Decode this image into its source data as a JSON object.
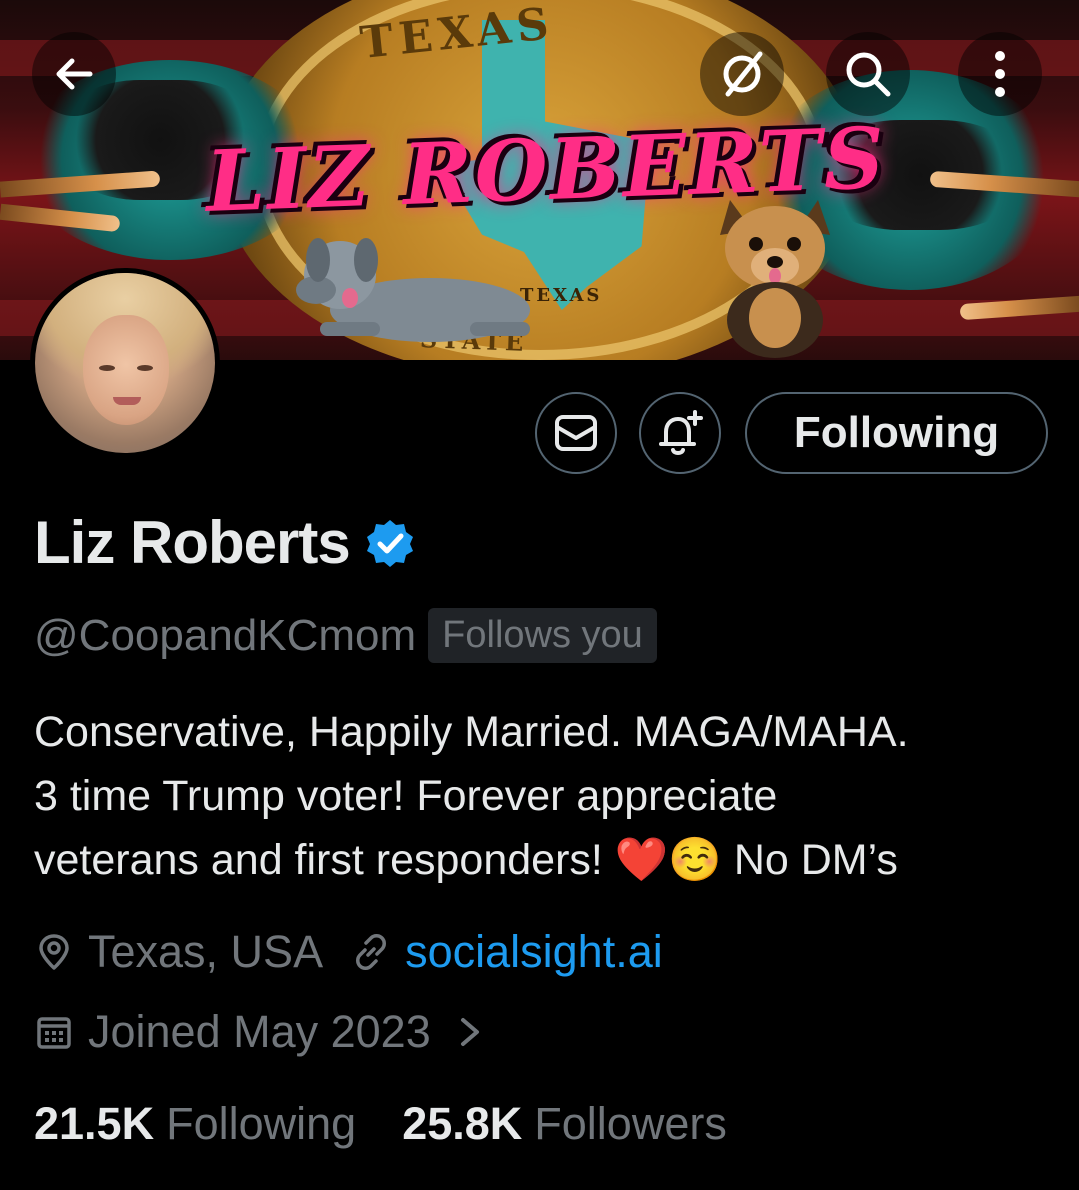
{
  "banner": {
    "title": "LIZ ROBERTS",
    "seal_text_top": "TEXAS",
    "seal_text_mid": "TEXAS",
    "seal_text_bottom": "STATE"
  },
  "nav": {
    "back_icon": "arrow-left-icon",
    "grok_icon": "grok-icon",
    "search_icon": "search-icon",
    "more_icon": "more-vertical-icon"
  },
  "actions": {
    "message_icon": "envelope-icon",
    "notify_icon": "bell-plus-icon",
    "following_label": "Following"
  },
  "profile": {
    "display_name": "Liz Roberts",
    "verified": true,
    "handle": "@CoopandKCmom",
    "follows_you": "Follows you",
    "bio_lines": [
      "Conservative, Happily Married. MAGA/MAHA.",
      "3 time Trump voter! Forever appreciate",
      "veterans and first responders! "
    ],
    "bio_emoji": "❤️☺️",
    "bio_tail": " No DM’s",
    "location": "Texas, USA",
    "website": "socialsight.ai",
    "joined": "Joined May 2023"
  },
  "stats": {
    "following_count": "21.5K",
    "following_label": "Following",
    "followers_count": "25.8K",
    "followers_label": "Followers"
  },
  "colors": {
    "background": "#000000",
    "text_primary": "#e7e9ea",
    "text_secondary": "#71767b",
    "link": "#1d9bf0",
    "verified": "#1d9bf0",
    "banner_pink": "#ff2d86"
  }
}
